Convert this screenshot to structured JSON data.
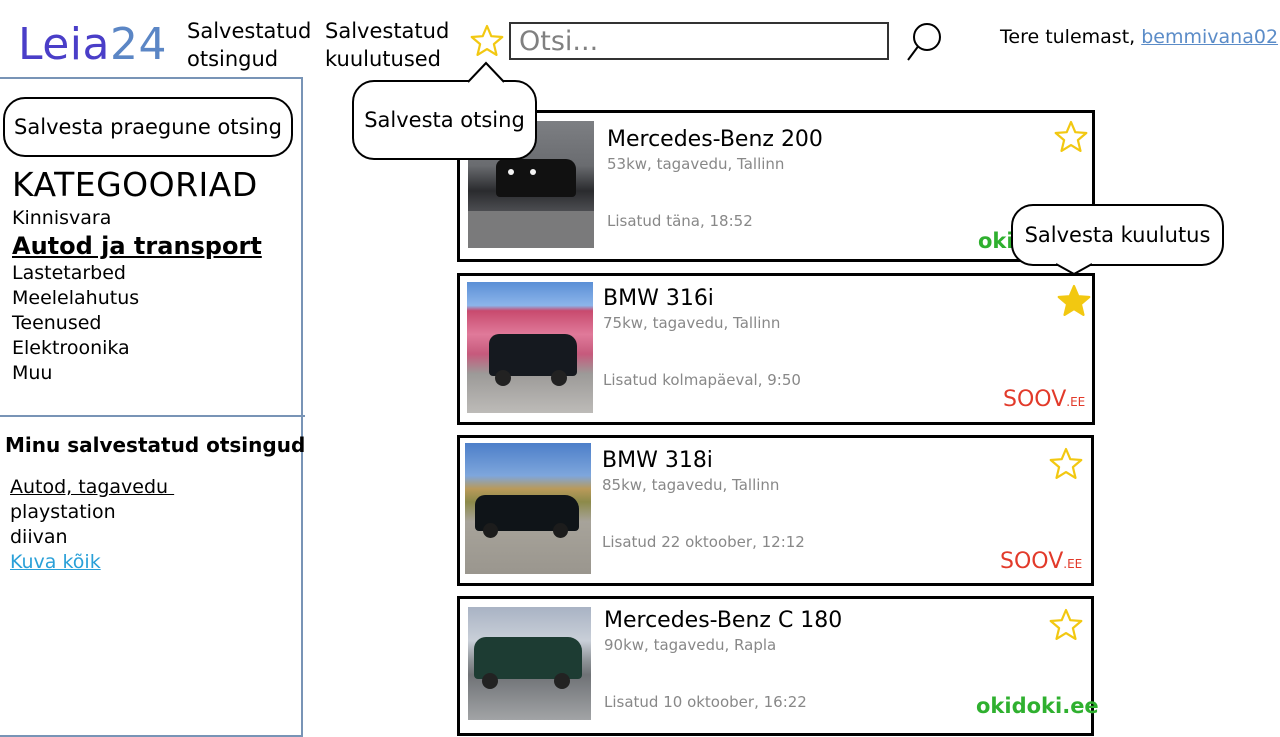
{
  "header": {
    "logo_part1": "Leia",
    "logo_part2": "24",
    "nav_saved_searches_line1": "Salvestatud",
    "nav_saved_searches_line2": "otsingud",
    "nav_saved_listings_line1": "Salvestatud",
    "nav_saved_listings_line2": "kuulutused",
    "search_placeholder": "Otsi...",
    "welcome_text": "Tere tulemast, ",
    "username": "bemmivana02"
  },
  "sidebar": {
    "save_current_search": "Salvesta praegune otsing",
    "categories_title": "KATEGOORIAD",
    "categories": [
      "Kinnisvara",
      "Autod ja transport",
      "Lastetarbed",
      "Meelelahutus",
      "Teenused",
      "Elektroonika",
      "Muu"
    ],
    "active_category": "Autod ja transport",
    "saved_searches_title": "Minu salvestatud otsingud",
    "saved_searches": [
      "Autod, tagavedu ",
      "playstation",
      "diivan"
    ],
    "show_all": "Kuva kõik"
  },
  "callouts": {
    "save_search": "Salvesta otsing",
    "save_listing": "Salvesta kuulutus"
  },
  "listings": [
    {
      "title": "Mercedes-Benz 200",
      "specs": "53kw, tagavedu, Tallinn",
      "date": "Lisatud täna, 18:52",
      "source": "okidoki.ee",
      "source_visible": "oki",
      "saved": false
    },
    {
      "title": "BMW 316i",
      "specs": "75kw, tagavedu, Tallinn",
      "date": "Lisatud kolmapäeval, 9:50",
      "source_main": "SOOV",
      "source_suffix": ".EE",
      "saved": true
    },
    {
      "title": "BMW 318i",
      "specs": "85kw, tagavedu, Tallinn",
      "date": "Lisatud 22 oktoober, 12:12",
      "source_main": "SOOV",
      "source_suffix": ".EE",
      "saved": false
    },
    {
      "title": "Mercedes-Benz C 180",
      "specs": "90kw, tagavedu, Rapla",
      "date": "Lisatud 10 oktoober, 16:22",
      "source": "okidoki.ee",
      "saved": false
    }
  ],
  "colors": {
    "logo_primary": "#4a3ec8",
    "logo_secondary": "#5b86c5",
    "sidebar_border": "#7894b6",
    "star_gold": "#f2c811",
    "okidoki_green": "#2fb02f",
    "soov_red": "#e23a2a",
    "link_blue": "#2aa0d8"
  },
  "icons": {
    "save_search_star": "star-outline-icon",
    "search_button": "magnifier-icon",
    "listing_star_empty": "star-outline-icon",
    "listing_star_filled": "star-filled-icon"
  }
}
